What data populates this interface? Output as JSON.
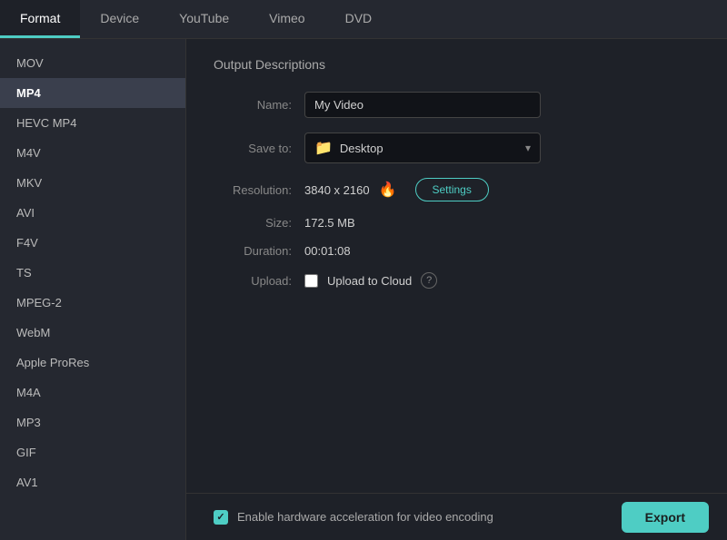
{
  "tabs": [
    {
      "id": "format",
      "label": "Format",
      "active": true
    },
    {
      "id": "device",
      "label": "Device",
      "active": false
    },
    {
      "id": "youtube",
      "label": "YouTube",
      "active": false
    },
    {
      "id": "vimeo",
      "label": "Vimeo",
      "active": false
    },
    {
      "id": "dvd",
      "label": "DVD",
      "active": false
    }
  ],
  "sidebar": {
    "items": [
      {
        "id": "mov",
        "label": "MOV",
        "active": false
      },
      {
        "id": "mp4",
        "label": "MP4",
        "active": true
      },
      {
        "id": "hevc-mp4",
        "label": "HEVC MP4",
        "active": false
      },
      {
        "id": "m4v",
        "label": "M4V",
        "active": false
      },
      {
        "id": "mkv",
        "label": "MKV",
        "active": false
      },
      {
        "id": "avi",
        "label": "AVI",
        "active": false
      },
      {
        "id": "f4v",
        "label": "F4V",
        "active": false
      },
      {
        "id": "ts",
        "label": "TS",
        "active": false
      },
      {
        "id": "mpeg2",
        "label": "MPEG-2",
        "active": false
      },
      {
        "id": "webm",
        "label": "WebM",
        "active": false
      },
      {
        "id": "apple-prores",
        "label": "Apple ProRes",
        "active": false
      },
      {
        "id": "m4a",
        "label": "M4A",
        "active": false
      },
      {
        "id": "mp3",
        "label": "MP3",
        "active": false
      },
      {
        "id": "gif",
        "label": "GIF",
        "active": false
      },
      {
        "id": "av1",
        "label": "AV1",
        "active": false
      }
    ]
  },
  "content": {
    "section_title": "Output Descriptions",
    "fields": {
      "name_label": "Name:",
      "name_value": "My Video",
      "save_to_label": "Save to:",
      "save_to_folder_icon": "📁",
      "save_to_value": "Desktop",
      "resolution_label": "Resolution:",
      "resolution_value": "3840 x 2160",
      "resolution_icon": "🔥",
      "settings_button": "Settings",
      "size_label": "Size:",
      "size_value": "172.5 MB",
      "duration_label": "Duration:",
      "duration_value": "00:01:08",
      "upload_label": "Upload:",
      "upload_to_cloud_label": "Upload to Cloud",
      "help_icon": "?"
    }
  },
  "bottom_bar": {
    "hw_accel_label": "Enable hardware acceleration for video encoding",
    "export_button": "Export"
  }
}
